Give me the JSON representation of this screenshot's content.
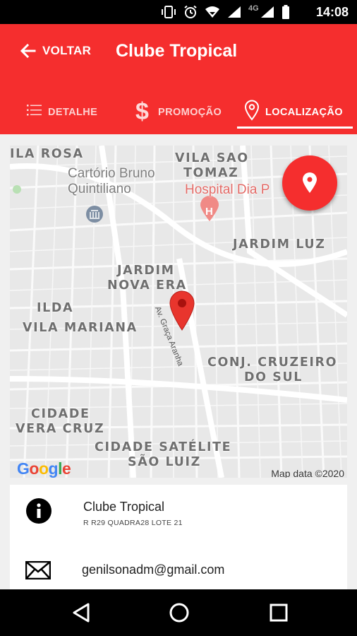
{
  "status_bar": {
    "time": "14:08",
    "network_label": "4G",
    "icons": [
      "vibrate-icon",
      "alarm-icon",
      "wifi-icon",
      "signal-icon",
      "battery-icon"
    ]
  },
  "app_bar": {
    "back_label": "VOLTAR",
    "title": "Clube Tropical",
    "color": "#f52e2e"
  },
  "tabs": [
    {
      "label": "DETALHE",
      "icon": "list-icon",
      "active": false
    },
    {
      "label": "PROMOÇÃO",
      "icon": "dollar-icon",
      "active": false
    },
    {
      "label": "LOCALIZAÇÃO",
      "icon": "location-pin-icon",
      "active": true
    }
  ],
  "map": {
    "neighborhoods": [
      "ILA ROSA",
      "VILA SAO",
      "TOMAZ",
      "JARDIM LUZ",
      "JARDIM",
      "NOVA ERA",
      "ILDA",
      "VILA MARIANA",
      "CONJ. CRUZEIRO",
      "DO SUL",
      "CIDADE",
      "VERA CRUZ",
      "CIDADE SATÉLITE",
      "SÃO LUIZ"
    ],
    "pois": [
      {
        "name": "Cartório Bruno",
        "name2": "Quintiliano",
        "icon": "bank-icon"
      },
      {
        "name": "Hospital Dia P",
        "icon": "hospital-icon"
      }
    ],
    "street": "Av. Graça Aranha",
    "logo": "Google",
    "attribution": "Map data ©2020"
  },
  "place": {
    "name": "Clube Tropical",
    "address": "R R29 QUADRA28 LOTE 21",
    "email": "genilsonadm@gmail.com"
  }
}
